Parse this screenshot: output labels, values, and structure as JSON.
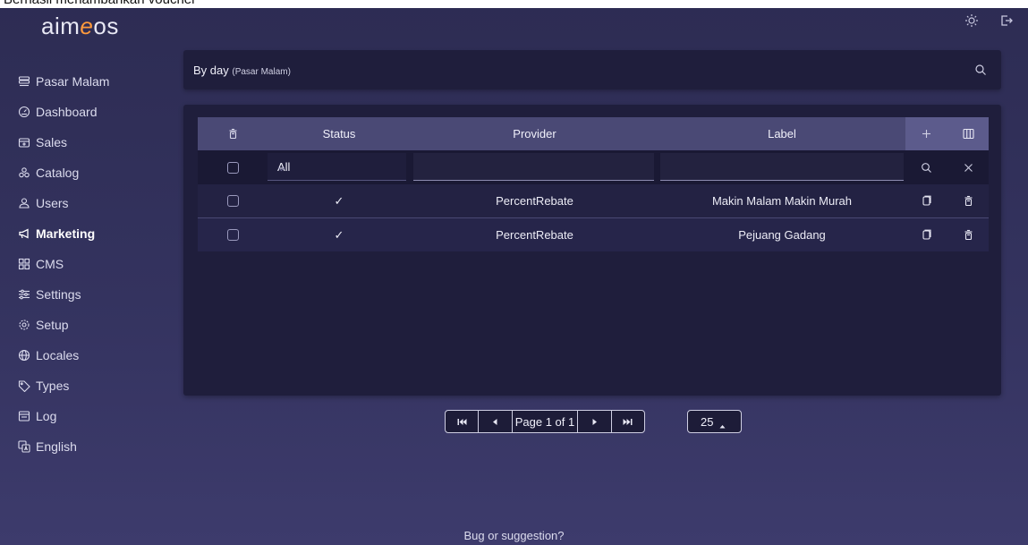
{
  "banner": {
    "text": "Berhasil menambahkan voucher"
  },
  "brand": {
    "logo_prefix": "aim",
    "logo_accent": "e",
    "logo_suffix": "os",
    "accent_color": "#ff9a3c"
  },
  "topbar": {
    "icons": [
      "sun-icon",
      "logout-icon"
    ]
  },
  "sidebar": {
    "items": [
      {
        "label": "Pasar Malam",
        "icon": "store-icon"
      },
      {
        "label": "Dashboard",
        "icon": "dashboard-icon"
      },
      {
        "label": "Sales",
        "icon": "sales-icon"
      },
      {
        "label": "Catalog",
        "icon": "catalog-icon"
      },
      {
        "label": "Users",
        "icon": "users-icon"
      },
      {
        "label": "Marketing",
        "icon": "megaphone-icon",
        "active": true
      },
      {
        "label": "CMS",
        "icon": "cms-icon"
      },
      {
        "label": "Settings",
        "icon": "sliders-icon"
      },
      {
        "label": "Setup",
        "icon": "gear-icon"
      },
      {
        "label": "Locales",
        "icon": "globe-icon"
      },
      {
        "label": "Types",
        "icon": "tag-icon"
      },
      {
        "label": "Log",
        "icon": "log-icon"
      },
      {
        "label": "English",
        "icon": "language-icon"
      }
    ]
  },
  "search_bar": {
    "title": "By day",
    "subtitle": "(Pasar Malam)"
  },
  "table": {
    "headers": {
      "status": "Status",
      "provider": "Provider",
      "label": "Label"
    },
    "filter": {
      "status_value": "All",
      "provider_value": "",
      "label_value": ""
    },
    "rows": [
      {
        "status": "✓",
        "provider": "PercentRebate",
        "label": "Makin Malam Makin Murah"
      },
      {
        "status": "✓",
        "provider": "PercentRebate",
        "label": "Pejuang Gadang"
      }
    ]
  },
  "pagination": {
    "page_label": "Page 1 of 1",
    "page_size": "25"
  },
  "footer": {
    "text": "Bug or suggestion?"
  }
}
